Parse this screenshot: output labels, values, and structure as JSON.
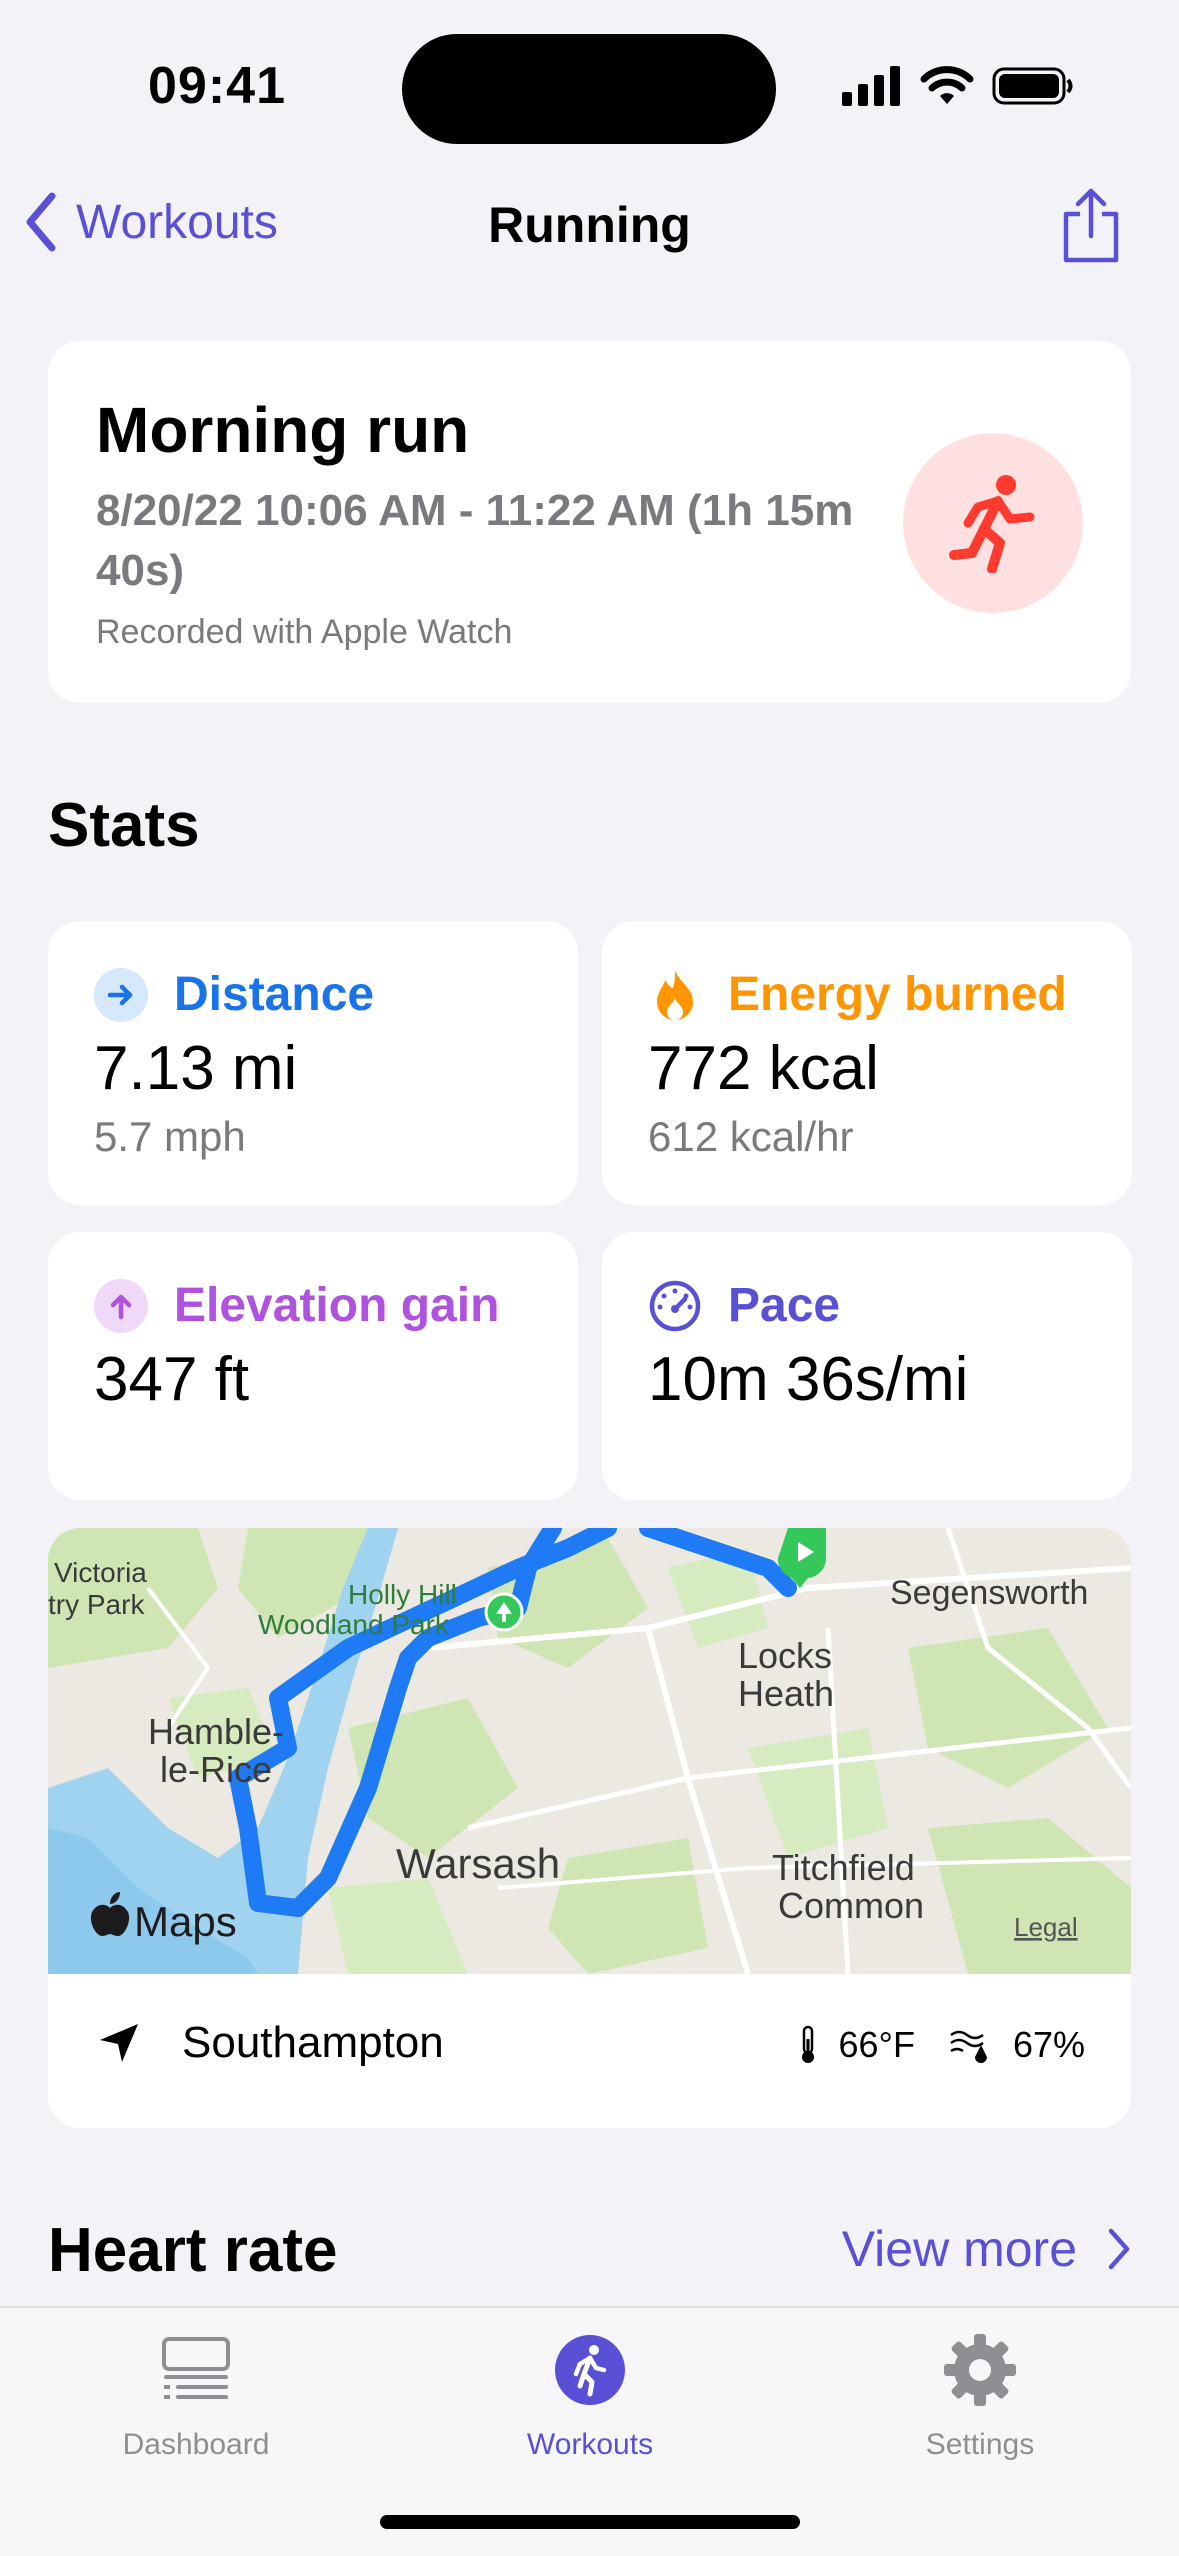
{
  "status_bar": {
    "time": "09:41"
  },
  "nav": {
    "back_label": "Workouts",
    "title": "Running"
  },
  "workout": {
    "title": "Morning run",
    "dates": "8/20/22 10:06 AM - 11:22 AM (1h 15m 40s)",
    "recorded": "Recorded with Apple Watch"
  },
  "stats": {
    "section_title": "Stats",
    "distance": {
      "label": "Distance",
      "value": "7.13 mi",
      "sub": "5.7 mph",
      "color": "#1a73e8"
    },
    "energy": {
      "label": "Energy burned",
      "value": "772 kcal",
      "sub": "612 kcal/hr",
      "color": "#ff9500"
    },
    "elevation": {
      "label": "Elevation gain",
      "value": "347 ft",
      "color": "#af52de"
    },
    "pace": {
      "label": "Pace",
      "value": "10m 36s/mi",
      "color": "#5a50d6"
    }
  },
  "map": {
    "labels": {
      "victoria": "Victoria",
      "country_park": "try Park",
      "holly_hill": "Holly Hill",
      "woodland_park": "Woodland Park",
      "segensworth": "Segensworth",
      "locks": "Locks",
      "heath": "Heath",
      "hamble": "Hamble-",
      "le_rice": "le-Rice",
      "warsash": "Warsash",
      "titchfield": "Titchfield",
      "common": "Common",
      "maps_logo": "Maps",
      "legal": "Legal"
    },
    "location": "Southampton",
    "temperature": "66°F",
    "humidity": "67%"
  },
  "heart_rate": {
    "title": "Heart rate",
    "view_more": "View more"
  },
  "tabs": [
    {
      "label": "Dashboard",
      "icon": "dashboard-icon"
    },
    {
      "label": "Workouts",
      "icon": "workouts-icon"
    },
    {
      "label": "Settings",
      "icon": "gear-icon"
    }
  ],
  "colors": {
    "accent": "#5a50d6",
    "run_red": "#ff3b30",
    "route_blue": "#1e7bf5"
  }
}
